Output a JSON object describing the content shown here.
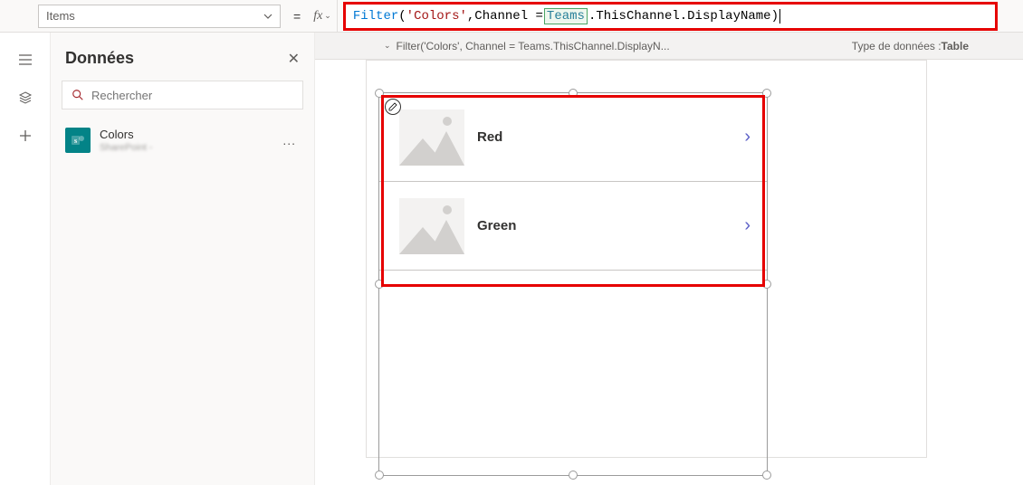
{
  "property_selector": {
    "value": "Items"
  },
  "equals": "=",
  "fx_label": "fx",
  "formula": {
    "func": "Filter",
    "open": "(",
    "arg1": "'Colors'",
    "sep": ", ",
    "arg2a": "Channel = ",
    "var": "Teams",
    "arg2b": ".ThisChannel.DisplayName",
    "close": ")"
  },
  "result": {
    "text": "Filter('Colors', Channel = Teams.ThisChannel.DisplayN...",
    "type_label": "Type de données :",
    "type_value": "Table"
  },
  "panel": {
    "title": "Données",
    "search_placeholder": "Rechercher",
    "datasource": {
      "name": "Colors",
      "subtitle": "SharePoint - ",
      "icon_letters": "s"
    },
    "more": "..."
  },
  "gallery": {
    "items": [
      {
        "label": "Red"
      },
      {
        "label": "Green"
      }
    ],
    "chevron": "›"
  },
  "icons": {
    "edit": "✎",
    "close": "✕",
    "search": "🔍"
  }
}
